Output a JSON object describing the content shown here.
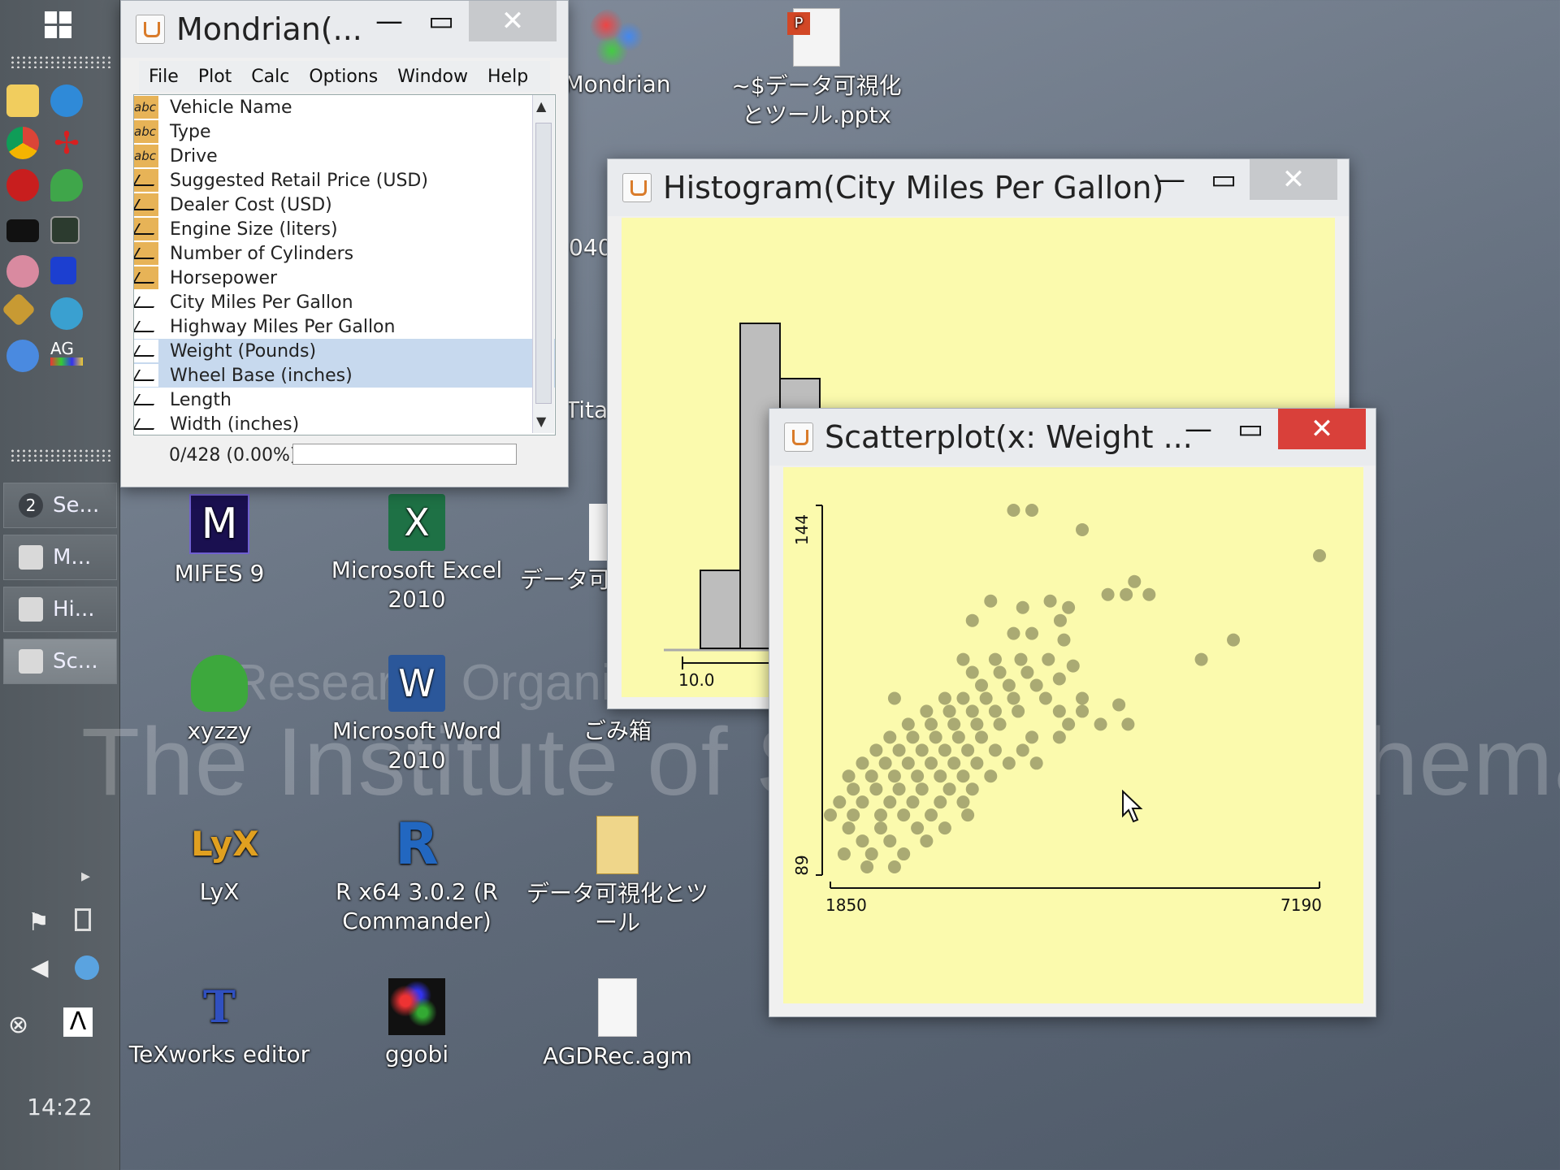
{
  "taskbar": {
    "task_buttons": [
      {
        "badge": "2",
        "label": "Se..."
      },
      {
        "label": "M..."
      },
      {
        "label": "Hi..."
      },
      {
        "label": "Sc..."
      }
    ],
    "clock": "14:22"
  },
  "desktop_icons": [
    {
      "label": "Mondrian"
    },
    {
      "label": "~$データ可視化とツール.pptx"
    },
    {
      "label": "MIFES 9"
    },
    {
      "label": "Microsoft Excel 2010"
    },
    {
      "label": "データ可視化とツール.pptx"
    },
    {
      "label": "xyzzy"
    },
    {
      "label": "Microsoft Word 2010"
    },
    {
      "label": "ごみ箱"
    },
    {
      "label": "LyX"
    },
    {
      "label": "R x64 3.0.2 (R Commander)"
    },
    {
      "label": "データ可視化とツール"
    },
    {
      "label": "TeXworks editor"
    },
    {
      "label": "ggobi"
    },
    {
      "label": "AGDRec.agm"
    }
  ],
  "partial_labels": {
    "p1": "040",
    "p2": "Titar"
  },
  "watermark": {
    "line1": "Research Organization",
    "line2": "The Institute of Statistical Mathematics"
  },
  "mondrian": {
    "title": "Mondrian(...",
    "menu": [
      "File",
      "Plot",
      "Calc",
      "Options",
      "Window",
      "Help"
    ],
    "variables": [
      {
        "name": "Vehicle Name",
        "kind": "abc"
      },
      {
        "name": "Type",
        "kind": "abc"
      },
      {
        "name": "Drive",
        "kind": "abc"
      },
      {
        "name": "Suggested Retail Price (USD)",
        "kind": "continuous"
      },
      {
        "name": "Dealer Cost (USD)",
        "kind": "continuous"
      },
      {
        "name": "Engine Size (liters)",
        "kind": "continuous"
      },
      {
        "name": "Number of Cylinders",
        "kind": "continuous"
      },
      {
        "name": "Horsepower",
        "kind": "continuous"
      },
      {
        "name": "City Miles Per Gallon",
        "kind": "continuous-plain"
      },
      {
        "name": "Highway Miles Per Gallon",
        "kind": "continuous-plain"
      },
      {
        "name": "Weight (Pounds)",
        "kind": "continuous-plain",
        "selected": true
      },
      {
        "name": "Wheel Base (inches)",
        "kind": "continuous-plain",
        "selected": true
      },
      {
        "name": "Length",
        "kind": "continuous-plain"
      },
      {
        "name": "Width (inches)",
        "kind": "continuous-plain"
      }
    ],
    "status": "0/428 (0.00%)",
    "selection_fraction": 0.0
  },
  "histogram": {
    "title": "Histogram(City Miles Per Gallon)",
    "xtick": "10.0"
  },
  "scatter": {
    "title": "Scatterplot(x: Weight ...",
    "x_min_label": "1850",
    "x_max_label": "7190",
    "y_min_label": "89",
    "y_max_label": "144"
  },
  "chart_data": [
    {
      "type": "bar",
      "title": "Histogram(City Miles Per Gallon)",
      "x_first_tick": 10.0,
      "bins_visible": [
        {
          "height_rel": 0.24
        },
        {
          "height_rel": 1.0
        },
        {
          "height_rel": 0.83
        }
      ]
    },
    {
      "type": "scatter",
      "title": "Scatterplot(x: Weight ...",
      "xlim": [
        1850,
        7190
      ],
      "ylim": [
        89,
        144
      ],
      "points": [
        [
          3850,
          144
        ],
        [
          4050,
          144
        ],
        [
          4600,
          141
        ],
        [
          7190,
          137
        ],
        [
          5170,
          133
        ],
        [
          4880,
          131
        ],
        [
          5080,
          131
        ],
        [
          5330,
          131
        ],
        [
          4250,
          130
        ],
        [
          3600,
          130
        ],
        [
          3950,
          129
        ],
        [
          4450,
          129
        ],
        [
          3400,
          127
        ],
        [
          4360,
          127
        ],
        [
          6250,
          124
        ],
        [
          3850,
          125
        ],
        [
          4050,
          125
        ],
        [
          4400,
          124
        ],
        [
          5900,
          121
        ],
        [
          3300,
          121
        ],
        [
          3650,
          121
        ],
        [
          3930,
          121
        ],
        [
          4230,
          121
        ],
        [
          4500,
          120
        ],
        [
          3400,
          119
        ],
        [
          3700,
          119
        ],
        [
          4000,
          119
        ],
        [
          4350,
          118
        ],
        [
          3500,
          117
        ],
        [
          3800,
          117
        ],
        [
          4100,
          117
        ],
        [
          2550,
          115
        ],
        [
          3100,
          115
        ],
        [
          3300,
          115
        ],
        [
          3550,
          115
        ],
        [
          3850,
          115
        ],
        [
          4200,
          115
        ],
        [
          4600,
          115
        ],
        [
          5000,
          114
        ],
        [
          2900,
          113
        ],
        [
          3150,
          113
        ],
        [
          3400,
          113
        ],
        [
          3650,
          113
        ],
        [
          3900,
          113
        ],
        [
          4350,
          113
        ],
        [
          4600,
          113
        ],
        [
          2700,
          111
        ],
        [
          2950,
          111
        ],
        [
          3200,
          111
        ],
        [
          3450,
          111
        ],
        [
          3700,
          111
        ],
        [
          4450,
          111
        ],
        [
          4800,
          111
        ],
        [
          5100,
          111
        ],
        [
          2500,
          109
        ],
        [
          2750,
          109
        ],
        [
          3000,
          109
        ],
        [
          3250,
          109
        ],
        [
          3500,
          109
        ],
        [
          4050,
          109
        ],
        [
          4350,
          109
        ],
        [
          2350,
          107
        ],
        [
          2600,
          107
        ],
        [
          2850,
          107
        ],
        [
          3100,
          107
        ],
        [
          3350,
          107
        ],
        [
          3650,
          107
        ],
        [
          3950,
          107
        ],
        [
          2200,
          105
        ],
        [
          2450,
          105
        ],
        [
          2700,
          105
        ],
        [
          2950,
          105
        ],
        [
          3200,
          105
        ],
        [
          3450,
          105
        ],
        [
          3800,
          105
        ],
        [
          4100,
          105
        ],
        [
          2050,
          103
        ],
        [
          2300,
          103
        ],
        [
          2550,
          103
        ],
        [
          2800,
          103
        ],
        [
          3050,
          103
        ],
        [
          3300,
          103
        ],
        [
          3600,
          103
        ],
        [
          2100,
          101
        ],
        [
          2350,
          101
        ],
        [
          2600,
          101
        ],
        [
          2850,
          101
        ],
        [
          3150,
          101
        ],
        [
          3400,
          101
        ],
        [
          1950,
          99
        ],
        [
          2200,
          99
        ],
        [
          2500,
          99
        ],
        [
          2750,
          99
        ],
        [
          3050,
          99
        ],
        [
          3300,
          99
        ],
        [
          1850,
          97
        ],
        [
          2100,
          97
        ],
        [
          2400,
          97
        ],
        [
          2650,
          97
        ],
        [
          2950,
          97
        ],
        [
          3350,
          97
        ],
        [
          2050,
          95
        ],
        [
          2400,
          95
        ],
        [
          2800,
          95
        ],
        [
          3100,
          95
        ],
        [
          2200,
          93
        ],
        [
          2500,
          93
        ],
        [
          2900,
          93
        ],
        [
          2000,
          91
        ],
        [
          2300,
          91
        ],
        [
          2650,
          91
        ],
        [
          2550,
          89
        ],
        [
          2250,
          89
        ]
      ]
    }
  ]
}
